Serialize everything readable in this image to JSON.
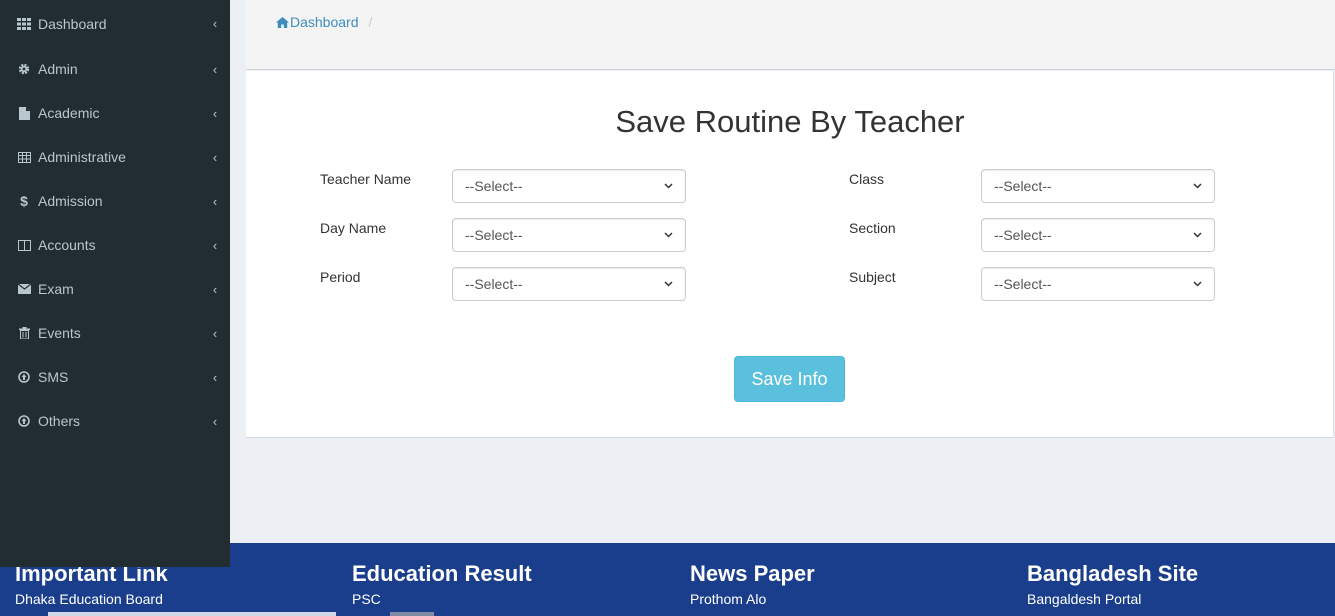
{
  "sidebar": {
    "items": [
      {
        "label": "Dashboard",
        "icon": "grid-icon"
      },
      {
        "label": "Admin",
        "icon": "gear-icon"
      },
      {
        "label": "Academic",
        "icon": "file-icon"
      },
      {
        "label": "Administrative",
        "icon": "table-icon"
      },
      {
        "label": "Admission",
        "icon": "dollar-icon"
      },
      {
        "label": "Accounts",
        "icon": "book-icon"
      },
      {
        "label": "Exam",
        "icon": "envelope-icon"
      },
      {
        "label": "Events",
        "icon": "trash-icon"
      },
      {
        "label": "SMS",
        "icon": "circle-arrow-icon"
      },
      {
        "label": "Others",
        "icon": "circle-arrow-icon"
      }
    ],
    "chevron": "‹"
  },
  "breadcrumb": {
    "home": "Dashboard",
    "separator": "/"
  },
  "form": {
    "title": "Save Routine By Teacher",
    "teacher_label": "Teacher Name",
    "teacher_value": "--Select--",
    "day_label": "Day Name",
    "day_value": "--Select--",
    "period_label": "Period",
    "period_value": "--Select--",
    "class_label": "Class",
    "class_value": "--Select--",
    "section_label": "Section",
    "section_value": "--Select--",
    "subject_label": "Subject",
    "subject_value": "--Select--",
    "save_label": "Save Info"
  },
  "footer": {
    "col1": {
      "title": "Important Link",
      "link": "Dhaka Education Board"
    },
    "col2": {
      "title": "Education Result",
      "link": "PSC"
    },
    "col3": {
      "title": "News Paper",
      "link": "Prothom Alo"
    },
    "col4": {
      "title": "Bangladesh Site",
      "link": "Bangaldesh Portal"
    }
  },
  "colors": {
    "sidebar_bg": "#222d32",
    "footer_bg": "#1a3e8c",
    "accent": "#3c8dbc",
    "button": "#5bc0de"
  }
}
